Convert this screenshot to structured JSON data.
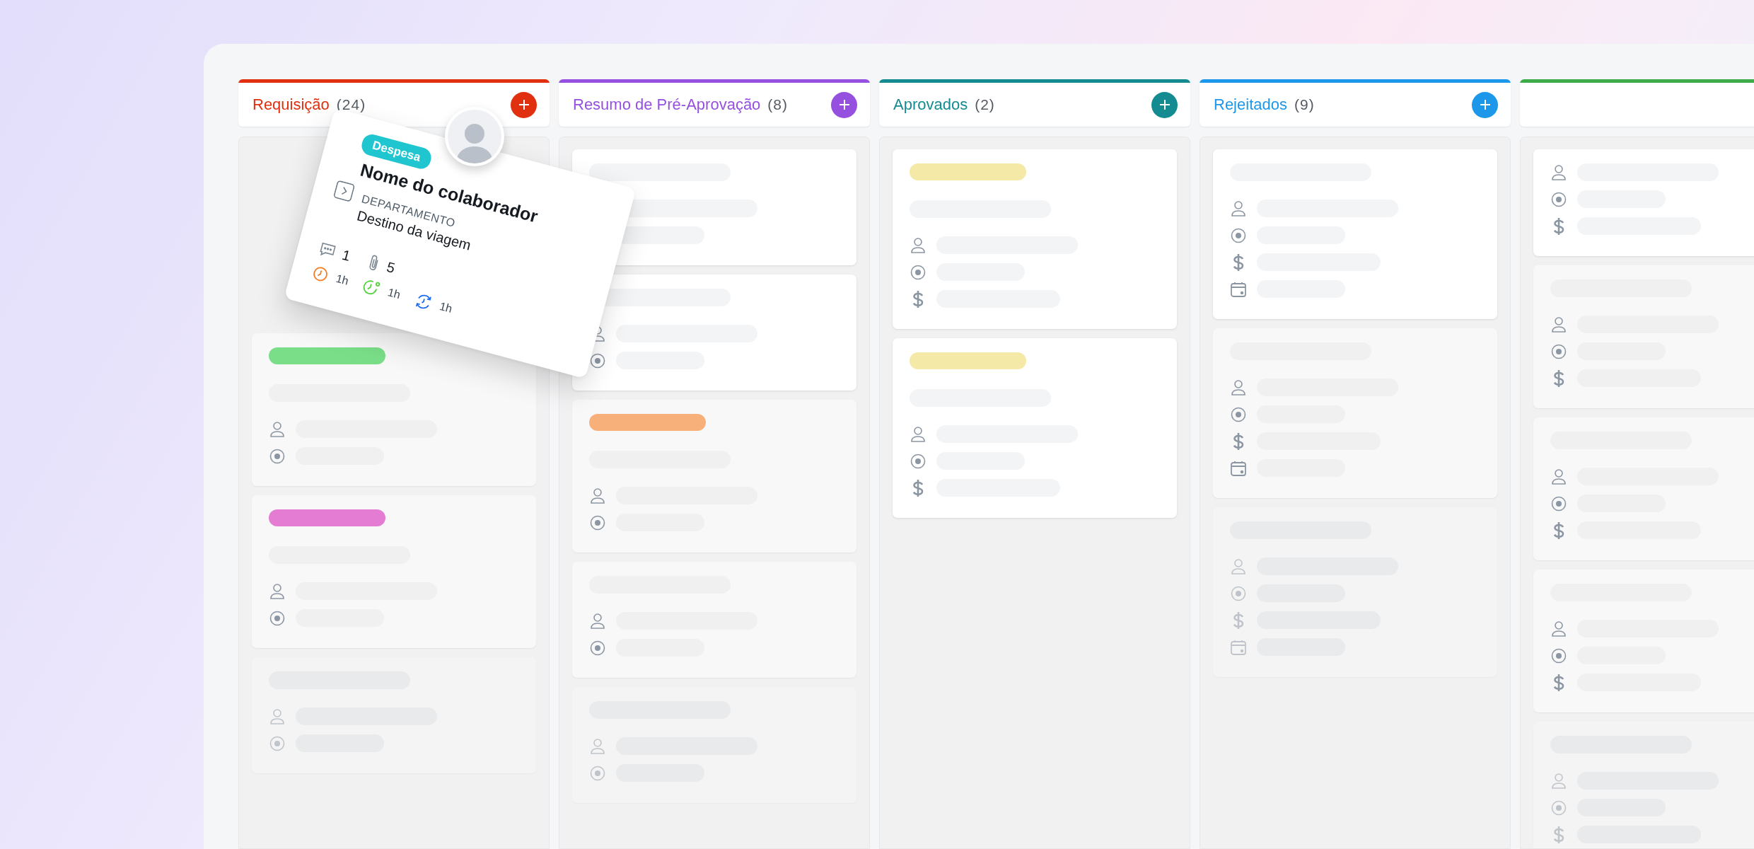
{
  "columns": [
    {
      "title": "Requisição",
      "count": "(24)",
      "color": "#e0300f",
      "cards": [
        {
          "kind": "slot"
        },
        {
          "kind": "flat",
          "lines": [
            {
              "kind": "tag",
              "color": "#7ade88"
            },
            {
              "kind": "bar"
            },
            {
              "kind": "person"
            },
            {
              "kind": "target"
            }
          ]
        },
        {
          "kind": "flat",
          "lines": [
            {
              "kind": "tag",
              "color": "#e47cd4"
            },
            {
              "kind": "bar"
            },
            {
              "kind": "person"
            },
            {
              "kind": "target"
            }
          ]
        },
        {
          "kind": "faded",
          "lines": [
            {
              "kind": "bar"
            },
            {
              "kind": "person"
            },
            {
              "kind": "target"
            }
          ]
        }
      ]
    },
    {
      "title": "Resumo de Pré-Aprovação",
      "count": "(8)",
      "color": "#9650e0",
      "cards": [
        {
          "kind": "raised",
          "lines": [
            {
              "kind": "bar"
            },
            {
              "kind": "row_long"
            },
            {
              "kind": "row_short"
            }
          ]
        },
        {
          "kind": "raised",
          "lines": [
            {
              "kind": "bar"
            },
            {
              "kind": "person"
            },
            {
              "kind": "target"
            }
          ]
        },
        {
          "kind": "flat",
          "lines": [
            {
              "kind": "tag",
              "color": "#f8b07a"
            },
            {
              "kind": "bar"
            },
            {
              "kind": "person"
            },
            {
              "kind": "target"
            }
          ]
        },
        {
          "kind": "flat",
          "lines": [
            {
              "kind": "bar"
            },
            {
              "kind": "person"
            },
            {
              "kind": "target"
            }
          ]
        },
        {
          "kind": "faded",
          "lines": [
            {
              "kind": "bar"
            },
            {
              "kind": "person"
            },
            {
              "kind": "target"
            }
          ]
        }
      ]
    },
    {
      "title": "Aprovados",
      "count": "(2)",
      "color": "#138b91",
      "cards": [
        {
          "kind": "raised",
          "lines": [
            {
              "kind": "tag",
              "color": "#f5e9a8"
            },
            {
              "kind": "bar"
            },
            {
              "kind": "person"
            },
            {
              "kind": "target"
            },
            {
              "kind": "dollar"
            }
          ]
        },
        {
          "kind": "raised",
          "lines": [
            {
              "kind": "tag",
              "color": "#f5e9a8"
            },
            {
              "kind": "bar"
            },
            {
              "kind": "person"
            },
            {
              "kind": "target"
            },
            {
              "kind": "dollar"
            }
          ]
        }
      ]
    },
    {
      "title": "Rejeitados",
      "count": "(9)",
      "color": "#1c97ea",
      "cards": [
        {
          "kind": "raised",
          "lines": [
            {
              "kind": "bar"
            },
            {
              "kind": "person"
            },
            {
              "kind": "target"
            },
            {
              "kind": "dollar"
            },
            {
              "kind": "calendar"
            }
          ]
        },
        {
          "kind": "flat",
          "lines": [
            {
              "kind": "bar"
            },
            {
              "kind": "person"
            },
            {
              "kind": "target"
            },
            {
              "kind": "dollar"
            },
            {
              "kind": "calendar"
            }
          ]
        },
        {
          "kind": "faded",
          "lines": [
            {
              "kind": "bar"
            },
            {
              "kind": "person"
            },
            {
              "kind": "target"
            },
            {
              "kind": "dollar"
            },
            {
              "kind": "calendar"
            }
          ]
        }
      ]
    },
    {
      "color": "#3dab47",
      "cards": [
        {
          "kind": "raised",
          "lines": [
            {
              "kind": "person"
            },
            {
              "kind": "target"
            },
            {
              "kind": "dollar"
            }
          ]
        },
        {
          "kind": "flat",
          "lines": [
            {
              "kind": "bar"
            },
            {
              "kind": "person"
            },
            {
              "kind": "target"
            },
            {
              "kind": "dollar"
            }
          ]
        },
        {
          "kind": "flat",
          "lines": [
            {
              "kind": "bar"
            },
            {
              "kind": "person"
            },
            {
              "kind": "target"
            },
            {
              "kind": "dollar"
            }
          ]
        },
        {
          "kind": "flat",
          "lines": [
            {
              "kind": "bar"
            },
            {
              "kind": "person"
            },
            {
              "kind": "target"
            },
            {
              "kind": "dollar"
            }
          ]
        },
        {
          "kind": "faded",
          "lines": [
            {
              "kind": "bar"
            },
            {
              "kind": "person"
            },
            {
              "kind": "target"
            },
            {
              "kind": "dollar"
            }
          ]
        }
      ]
    }
  ],
  "dragged_card": {
    "tag": "Despesa",
    "name": "Nome do colaborador",
    "department": "DEPARTAMENTO",
    "destination": "Destino da viagem",
    "comments": "1",
    "attachments": "5",
    "timers": [
      {
        "kind": "elapsed",
        "value": "1h"
      },
      {
        "kind": "started",
        "value": "1h"
      },
      {
        "kind": "sync",
        "value": "1h"
      }
    ]
  }
}
